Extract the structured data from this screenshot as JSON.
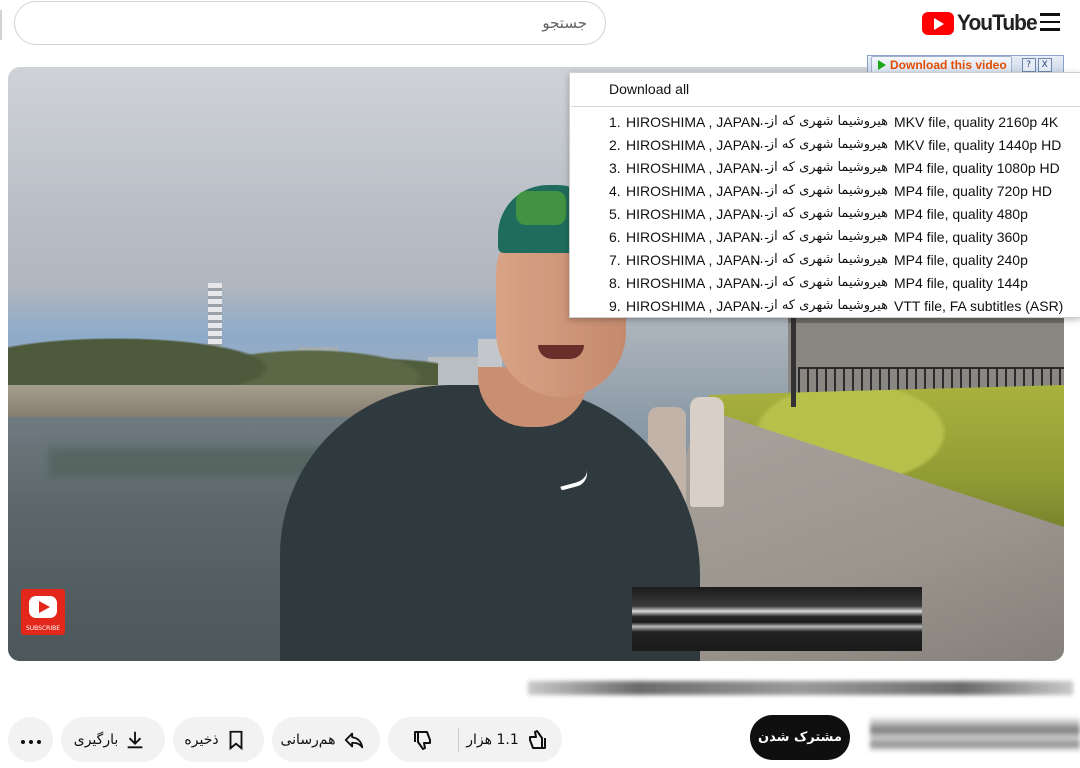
{
  "header": {
    "search_placeholder": "جستجو",
    "logo_text": "YouTube"
  },
  "video": {
    "subscribe_badge_label": "SUBSCRIBE"
  },
  "downloader": {
    "button_label": "Download this video",
    "help_label": "?",
    "close_label": "X",
    "download_all": "Download all",
    "items": [
      {
        "num": "1.",
        "title_en": "HIROSHIMA , JAPAN -",
        "title_fa": "هیروشیما شهری که از ...",
        "file": "MKV file, quality 2160p 4K"
      },
      {
        "num": "2.",
        "title_en": "HIROSHIMA , JAPAN -",
        "title_fa": "هیروشیما شهری که از ...",
        "file": "MKV file, quality 1440p HD"
      },
      {
        "num": "3.",
        "title_en": "HIROSHIMA , JAPAN -",
        "title_fa": "هیروشیما شهری که از ...",
        "file": "MP4 file, quality 1080p HD"
      },
      {
        "num": "4.",
        "title_en": "HIROSHIMA , JAPAN -",
        "title_fa": "هیروشیما شهری که از ...",
        "file": "MP4 file, quality 720p HD"
      },
      {
        "num": "5.",
        "title_en": "HIROSHIMA , JAPAN -",
        "title_fa": "هیروشیما شهری که از ...",
        "file": "MP4 file, quality 480p"
      },
      {
        "num": "6.",
        "title_en": "HIROSHIMA , JAPAN -",
        "title_fa": "هیروشیما شهری که از ...",
        "file": "MP4 file, quality 360p"
      },
      {
        "num": "7.",
        "title_en": "HIROSHIMA , JAPAN -",
        "title_fa": "هیروشیما شهری که از ...",
        "file": "MP4 file, quality 240p"
      },
      {
        "num": "8.",
        "title_en": "HIROSHIMA , JAPAN -",
        "title_fa": "هیروشیما شهری که از ...",
        "file": "MP4 file, quality 144p"
      },
      {
        "num": "9.",
        "title_en": "HIROSHIMA , JAPAN -",
        "title_fa": "هیروشیما شهری که از ...",
        "file": "VTT file, FA subtitles (ASR)"
      }
    ]
  },
  "actions": {
    "download_label": "بارگیری",
    "save_label": "ذخیره",
    "share_label": "هم‌رسانی",
    "like_count": "1.1 هزار",
    "subscribe_label": "مشترک شدن"
  },
  "icons": {
    "menu": "hamburger-menu-icon",
    "more": "more-horizontal-icon",
    "download": "download-icon",
    "save": "bookmark-icon",
    "share": "share-arrow-icon",
    "like": "thumbs-up-icon",
    "dislike": "thumbs-down-icon"
  },
  "colors": {
    "youtube_red": "#ff0000",
    "download_label": "#e14d00",
    "subscribe_bg": "#0f0f0f"
  }
}
